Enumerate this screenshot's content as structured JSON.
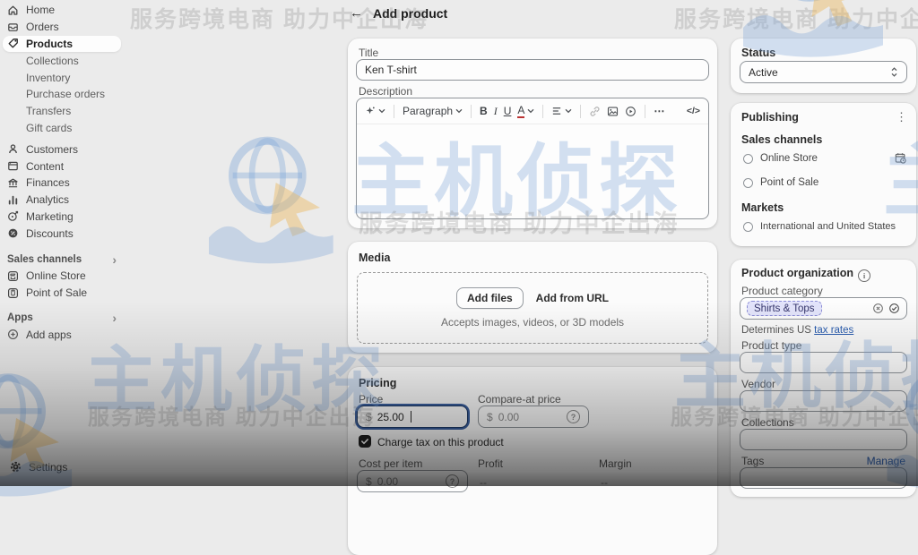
{
  "watermark": {
    "brand": "主机侦探",
    "slogan": "服务跨境电商 助力中企出海"
  },
  "header": {
    "back": "←",
    "title": "Add product"
  },
  "sidebar": {
    "items": [
      {
        "label": "Home",
        "icon": "home",
        "kind": "item"
      },
      {
        "label": "Orders",
        "icon": "orders",
        "kind": "item"
      },
      {
        "label": "Products",
        "icon": "products",
        "kind": "item",
        "selected": true
      },
      {
        "label": "Collections",
        "kind": "sub"
      },
      {
        "label": "Inventory",
        "kind": "sub"
      },
      {
        "label": "Purchase orders",
        "kind": "sub"
      },
      {
        "label": "Transfers",
        "kind": "sub"
      },
      {
        "label": "Gift cards",
        "kind": "sub",
        "gap": 5
      },
      {
        "label": "Customers",
        "icon": "customers",
        "kind": "item"
      },
      {
        "label": "Content",
        "icon": "content",
        "kind": "item"
      },
      {
        "label": "Finances",
        "icon": "finances",
        "kind": "item"
      },
      {
        "label": "Analytics",
        "icon": "analytics",
        "kind": "item"
      },
      {
        "label": "Marketing",
        "icon": "marketing",
        "kind": "item"
      },
      {
        "label": "Discounts",
        "icon": "discounts",
        "kind": "item",
        "gap": 10
      },
      {
        "label": "Sales channels",
        "kind": "header",
        "chevron": "›"
      },
      {
        "label": "Online Store",
        "icon": "online-store",
        "kind": "item"
      },
      {
        "label": "Point of Sale",
        "icon": "pos",
        "kind": "item",
        "gap": 9
      },
      {
        "label": "Apps",
        "kind": "header",
        "chevron": "›"
      },
      {
        "label": "Add apps",
        "icon": "add",
        "kind": "item"
      }
    ],
    "settings_label": "Settings"
  },
  "main": {
    "product": {
      "title_label": "Title",
      "title_value": "Ken T-shirt",
      "description_label": "Description"
    },
    "toolbar": {
      "paragraph": "Paragraph",
      "bold": "B",
      "italic": "I",
      "underline": "U",
      "color": "A",
      "more": "⋯",
      "code": "</>"
    },
    "media": {
      "heading": "Media",
      "add_files": "Add files",
      "add_from_url": "Add from URL",
      "hint": "Accepts images, videos, or 3D models"
    },
    "pricing": {
      "heading": "Pricing",
      "price_label": "Price",
      "currency": "$",
      "price_value": "25.00",
      "compare_label": "Compare-at price",
      "compare_placeholder": "0.00",
      "tax_checkbox_label": "Charge tax on this product",
      "cost_label": "Cost per item",
      "cost_placeholder": "0.00",
      "profit_label": "Profit",
      "profit_value": "--",
      "margin_label": "Margin",
      "margin_value": "--"
    }
  },
  "aside": {
    "status": {
      "heading": "Status",
      "value": "Active"
    },
    "publishing": {
      "heading": "Publishing",
      "sales_channels_label": "Sales channels",
      "channels": [
        "Online Store",
        "Point of Sale"
      ],
      "markets_label": "Markets",
      "markets": [
        "International and United States"
      ]
    },
    "organization": {
      "heading": "Product organization",
      "category_label": "Product category",
      "category_value": "Shirts & Tops",
      "tax_note_prefix": "Determines US ",
      "tax_link": "tax rates",
      "type_label": "Product type",
      "vendor_label": "Vendor",
      "collections_label": "Collections",
      "tags_label": "Tags",
      "manage_label": "Manage"
    }
  },
  "colors": {
    "accent_blue": "#2a5db0",
    "focus_ring": "#3a5f9e",
    "tag_bg": "#e3e4fb",
    "watermark_blue": "#7da5d7"
  }
}
